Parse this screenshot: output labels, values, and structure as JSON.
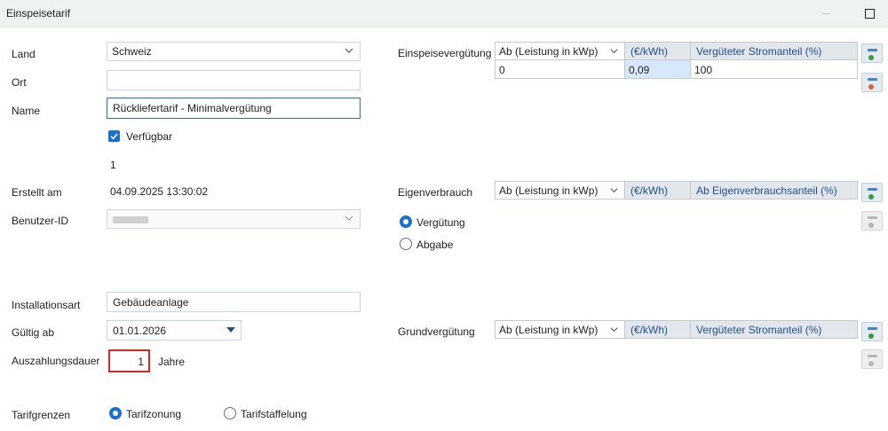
{
  "window": {
    "title": "Einspeisetarif"
  },
  "left": {
    "land_label": "Land",
    "land_value": "Schweiz",
    "ort_label": "Ort",
    "ort_value": "",
    "name_label": "Name",
    "name_value": "Rückliefertarif - Minimalvergütung",
    "verfuegbar_label": "Verfügbar",
    "verfuegbar_checked": true,
    "id_value": "1",
    "erstellt_label": "Erstellt am",
    "erstellt_value": "04.09.2025 13:30:02",
    "benutzer_label": "Benutzer-ID",
    "benutzer_value": "",
    "installationsart_label": "Installationsart",
    "installationsart_value": "Gebäudeanlage",
    "gueltig_label": "Gültig ab",
    "gueltig_value": "01.01.2026",
    "auszahlung_label": "Auszahlungsdauer",
    "auszahlung_value": "1",
    "auszahlung_unit": "Jahre",
    "tarifgrenzen_label": "Tarifgrenzen",
    "tarifzonung_label": "Tarifzonung",
    "tarifstaffelung_label": "Tarifstaffelung",
    "tarifgrenzen_selected": "Tarifzonung"
  },
  "einspeise": {
    "label": "Einspeisevergütung",
    "col_ab": "Ab (Leistung in kWp)",
    "col_price": "(€/kWh)",
    "col_share": "Vergüteter Stromanteil (%)",
    "rows": [
      {
        "ab": "0",
        "price": "0,09",
        "share": "100"
      }
    ]
  },
  "eigen": {
    "label": "Eigenverbrauch",
    "col_ab": "Ab (Leistung in kWp)",
    "col_price": "(€/kWh)",
    "col_share": "Ab Eigenverbrauchsanteil (%)",
    "opt_verguetung": "Vergütung",
    "opt_abgabe": "Abgabe",
    "selected": "Vergütung"
  },
  "grund": {
    "label": "Grundvergütung",
    "col_ab": "Ab (Leistung in kWp)",
    "col_price": "(€/kWh)",
    "col_share": "Vergüteter Stromanteil (%)"
  },
  "colors": {
    "accent": "#1a6fd6",
    "header_blue_text": "#1e4f8c",
    "selected_cell": "#d6e8fa",
    "add_green": "#3b9c3b",
    "remove_red": "#d9633b",
    "highlight_border": "#d7262c"
  },
  "icons": {
    "add_row": "add-row-icon",
    "remove_row": "remove-row-icon",
    "dropdown": "chevron-down-icon",
    "maximize": "maximize-icon"
  }
}
